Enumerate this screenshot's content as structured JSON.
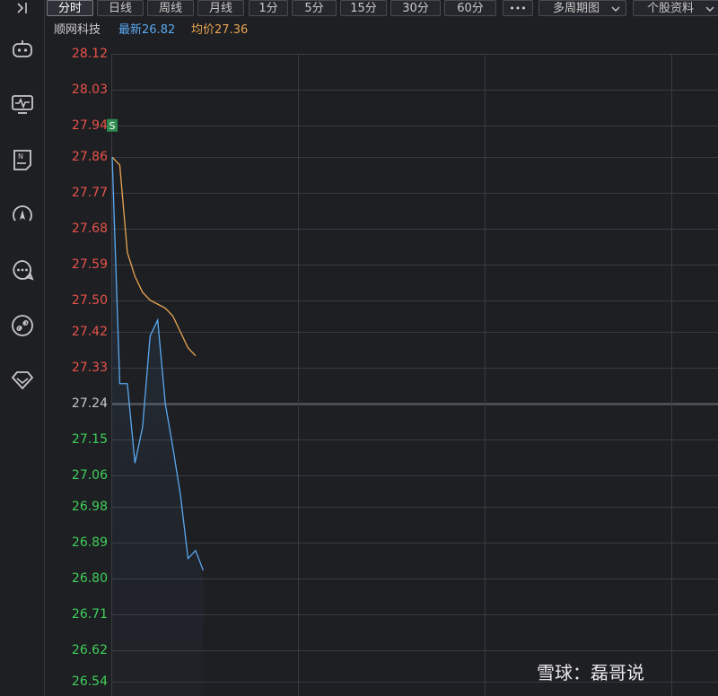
{
  "toolbar": {
    "collapse_icon": "collapse-right-icon",
    "tabs": [
      "分时",
      "日线",
      "周线",
      "月线",
      "1分",
      "5分",
      "15分",
      "30分",
      "60分"
    ],
    "more_label": "•••",
    "multi_period_label": "多周期图",
    "stock_info_label": "个股资料",
    "active_tab": "分时"
  },
  "sidebar": {
    "icons": [
      "robot-icon",
      "monitor-chart-icon",
      "news-icon",
      "gauge-icon",
      "chat-icon",
      "link-icon",
      "diamond-icon"
    ]
  },
  "info": {
    "stock_name": "顺网科技",
    "latest_label": "最新",
    "latest_value": "26.82",
    "avg_label": "均价",
    "avg_value": "27.36"
  },
  "colors": {
    "background": "#1e1f23",
    "grid": "#3a3b40",
    "up": "#e8524a",
    "down": "#3fcf5a",
    "price_line": "#5aa8f0",
    "avg_line": "#e8a550",
    "latest_text": "#5aa8f0",
    "avg_text": "#e8a550"
  },
  "chart_data": {
    "type": "line",
    "title": "",
    "xlabel": "",
    "ylabel": "",
    "y_ticks": [
      "28.12",
      "28.03",
      "27.94",
      "27.86",
      "27.77",
      "27.68",
      "27.59",
      "27.50",
      "27.42",
      "27.33",
      "27.24",
      "27.15",
      "27.06",
      "26.98",
      "26.89",
      "26.80",
      "26.71",
      "26.62",
      "26.54"
    ],
    "reference_price": 27.24,
    "ylim": [
      26.54,
      28.12
    ],
    "minutes_total": 240,
    "minute": [
      0,
      1,
      2,
      3,
      4,
      5,
      6,
      7,
      8,
      9,
      10,
      11,
      12,
      13,
      14
    ],
    "series": [
      {
        "name": "",
        "key": "price",
        "values": [
          27.86,
          27.29,
          27.29,
          27.09,
          27.18,
          27.41,
          27.45,
          27.24,
          27.13,
          27.01,
          26.85,
          26.87,
          26.82
        ]
      },
      {
        "name": "",
        "key": "avg",
        "values": [
          27.86,
          27.84,
          27.62,
          27.56,
          27.52,
          27.5,
          27.49,
          27.48,
          27.46,
          27.42,
          27.38,
          27.36
        ]
      }
    ],
    "marker": {
      "label": "S",
      "minute": 0,
      "price": 27.94,
      "color": "#2e8b4f"
    },
    "grid": true
  },
  "watermark": "雪球：磊哥说"
}
